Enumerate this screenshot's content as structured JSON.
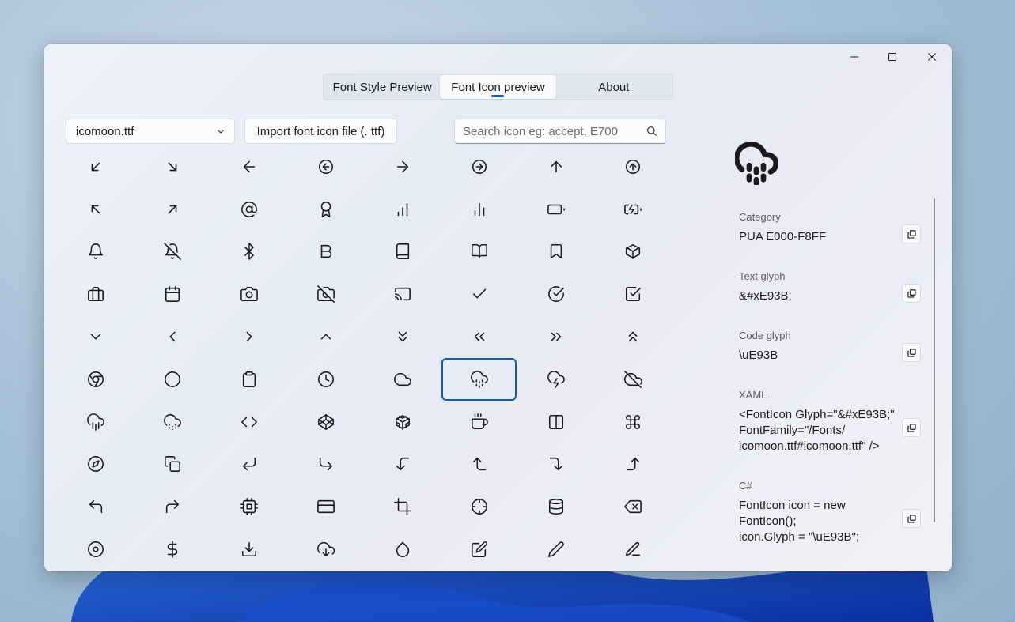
{
  "window": {
    "controls": {
      "minimize": "minimize-icon",
      "maximize": "maximize-icon",
      "close": "close-icon"
    }
  },
  "tabs": [
    {
      "label": "Font Style Preview",
      "active": false
    },
    {
      "label": "Font Icon preview",
      "active": true
    },
    {
      "label": "About",
      "active": false
    }
  ],
  "toolbar": {
    "font_file": "icomoon.ttf",
    "import_label": "Import font icon file (. ttf)",
    "search_placeholder": "Search icon eg: accept, E700",
    "search_value": ""
  },
  "icons": [
    "arrow-down-left",
    "arrow-down-right",
    "arrow-left",
    "arrow-left-circle",
    "arrow-right",
    "arrow-right-circle",
    "arrow-up",
    "arrow-up-circle",
    "arrow-up-left",
    "arrow-up-right",
    "at-sign",
    "award",
    "bar-chart",
    "bar-chart-2",
    "battery",
    "battery-charging",
    "bell",
    "bell-off",
    "bluetooth",
    "bold",
    "book",
    "book-open",
    "bookmark",
    "box",
    "briefcase",
    "calendar",
    "camera",
    "camera-off",
    "cast",
    "check",
    "check-circle",
    "check-square",
    "chevron-down",
    "chevron-left",
    "chevron-right",
    "chevron-up",
    "chevrons-down",
    "chevrons-left",
    "chevrons-right",
    "chevrons-up",
    "chrome",
    "circle",
    "clipboard",
    "clock",
    "cloud",
    "cloud-drizzle",
    "cloud-lightning",
    "cloud-off",
    "cloud-rain",
    "cloud-snow",
    "code",
    "codepen",
    "codesandbox",
    "coffee",
    "columns",
    "command",
    "compass",
    "copy",
    "corner-down-left",
    "corner-down-right",
    "corner-left-down",
    "corner-left-up",
    "corner-right-down",
    "corner-right-up",
    "corner-up-left",
    "corner-up-right",
    "cpu",
    "credit-card",
    "crop",
    "crosshair",
    "database",
    "delete",
    "disc",
    "dollar-sign",
    "download",
    "download-cloud",
    "droplet",
    "edit",
    "edit-2",
    "edit-3"
  ],
  "selected_icon_index": 45,
  "details": {
    "big_icon": "cloud-drizzle-icon",
    "category_label": "Category",
    "category_value": "PUA E000-F8FF",
    "text_glyph_label": "Text glyph",
    "text_glyph_value": "&#xE93B;",
    "code_glyph_label": "Code glyph",
    "code_glyph_value": "\\uE93B",
    "xaml_label": "XAML",
    "xaml_value": "<FontIcon Glyph=\"&#xE93B;\"\nFontFamily=\"/Fonts/\nicomoon.ttf#icomoon.ttf\" />",
    "csharp_label": "C#",
    "csharp_value": "FontIcon icon = new\nFontIcon();\nicon.Glyph = \"\\uE93B\";"
  },
  "colors": {
    "accent": "#0a5fb4"
  }
}
